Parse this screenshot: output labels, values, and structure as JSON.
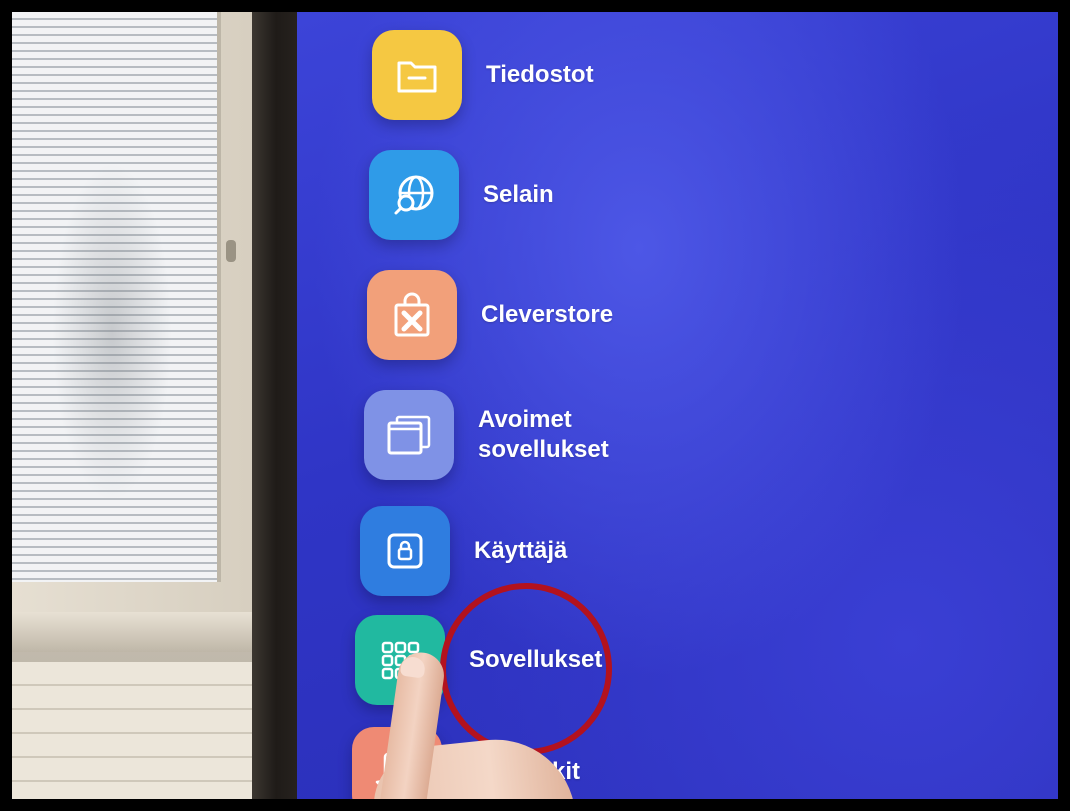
{
  "menu": {
    "items": [
      {
        "label": "Tiedostot",
        "icon": "folder-icon",
        "color": "#f5c842"
      },
      {
        "label": "Selain",
        "icon": "globe-search-icon",
        "color": "#2f9be8"
      },
      {
        "label": "Cleverstore",
        "icon": "shopping-bag-icon",
        "color": "#f2a07a"
      },
      {
        "label": "Avoimet\nsovellukset",
        "icon": "windows-icon",
        "color": "#7f92e6"
      },
      {
        "label": "Käyttäjä",
        "icon": "lock-icon",
        "color": "#2f7de0"
      },
      {
        "label": "Sovellukset",
        "icon": "apps-grid-icon",
        "color": "#21b9a0"
      },
      {
        "label": "kit",
        "icon": "star-card-icon",
        "color": "#ef8a74"
      }
    ]
  },
  "highlight": {
    "target": "Sovellukset",
    "color": "#b3121e"
  }
}
